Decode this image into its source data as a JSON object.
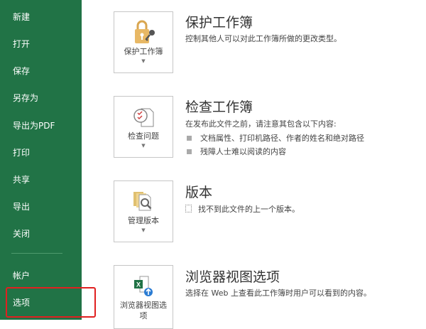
{
  "sidebar": {
    "items": [
      "新建",
      "打开",
      "保存",
      "另存为",
      "导出为PDF",
      "打印",
      "共享",
      "导出",
      "关闭"
    ],
    "account": "帐户",
    "options": "选项"
  },
  "sections": [
    {
      "button": "保护工作簿",
      "title": "保护工作簿",
      "desc": "控制其他人可以对此工作簿所做的更改类型。"
    },
    {
      "button": "检查问题",
      "title": "检查工作簿",
      "desc": "在发布此文件之前，请注意其包含以下内容:",
      "bullets": [
        "文档属性、打印机路径、作者的姓名和绝对路径",
        "残障人士难以阅读的内容"
      ]
    },
    {
      "button": "管理版本",
      "title": "版本",
      "desc": "找不到此文件的上一个版本。"
    },
    {
      "button": "浏览器视图选项",
      "title": "浏览器视图选项",
      "desc": "选择在 Web 上查看此工作簿时用户可以看到的内容。"
    }
  ],
  "colors": {
    "sidebar": "#217346",
    "highlight": "#e02020"
  }
}
